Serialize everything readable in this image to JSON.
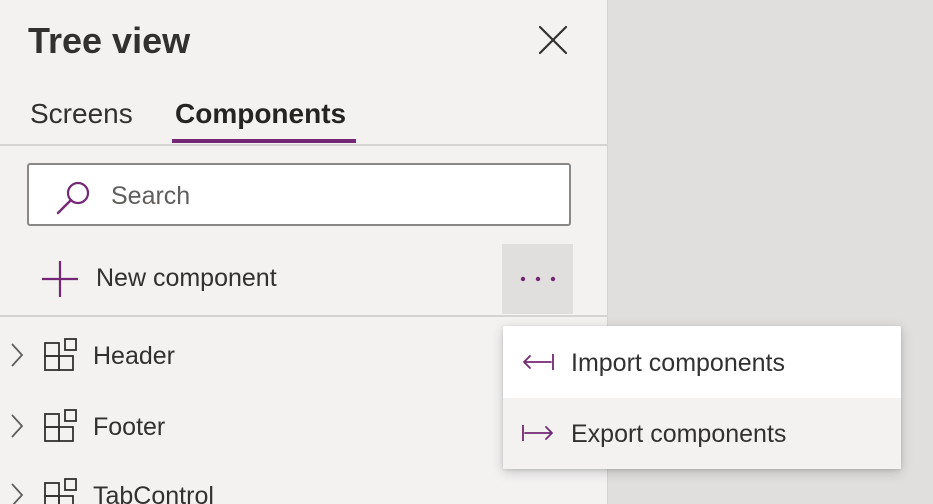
{
  "panel": {
    "title": "Tree view",
    "close_icon": "close-icon",
    "tabs": [
      {
        "label": "Screens",
        "active": false
      },
      {
        "label": "Components",
        "active": true
      }
    ],
    "search": {
      "placeholder": "Search",
      "value": "",
      "icon": "search-icon"
    },
    "new_component": {
      "label": "New component",
      "icon": "plus-icon"
    },
    "more_button": {
      "icon": "more-horizontal-icon"
    },
    "components": [
      {
        "name": "Header",
        "icon": "component-icon"
      },
      {
        "name": "Footer",
        "icon": "component-icon"
      },
      {
        "name": "TabControl",
        "icon": "component-icon"
      }
    ]
  },
  "context_menu": {
    "items": [
      {
        "label": "Import components",
        "icon": "import-arrow-icon"
      },
      {
        "label": "Export components",
        "icon": "export-arrow-icon"
      }
    ]
  },
  "colors": {
    "accent": "#742774",
    "panel_bg": "#f3f2f1",
    "canvas_bg": "#e1dfdd",
    "text": "#323130"
  }
}
